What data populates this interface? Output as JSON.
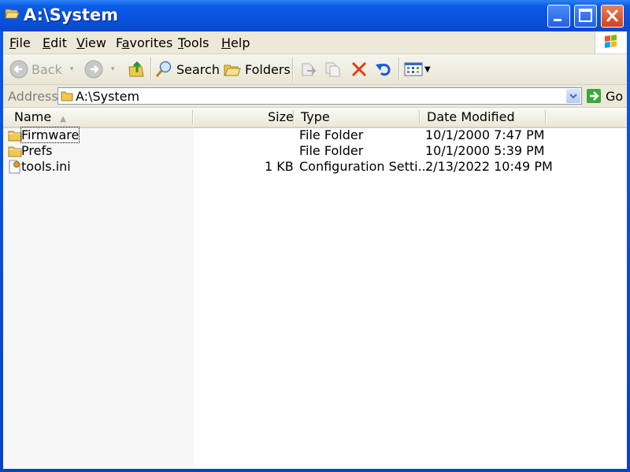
{
  "window": {
    "title": "A:\\System",
    "controls": {
      "minimize": "minimize",
      "maximize": "maximize",
      "close": "close"
    }
  },
  "menubar": {
    "items": [
      {
        "label": "File",
        "accel": "F"
      },
      {
        "label": "Edit",
        "accel": "E"
      },
      {
        "label": "View",
        "accel": "V"
      },
      {
        "label": "Favorites",
        "accel": "a"
      },
      {
        "label": "Tools",
        "accel": "T"
      },
      {
        "label": "Help",
        "accel": "H"
      }
    ]
  },
  "toolbar": {
    "back_label": "Back",
    "search_label": "Search",
    "folders_label": "Folders"
  },
  "address": {
    "label": "Address",
    "value": "A:\\System",
    "go_label": "Go"
  },
  "list": {
    "columns": [
      {
        "label": "Name",
        "sorted": "ascending"
      },
      {
        "label": "Size"
      },
      {
        "label": "Type"
      },
      {
        "label": "Date Modified"
      }
    ],
    "rows": [
      {
        "name": "Firmware",
        "size": "",
        "type": "File Folder",
        "modified": "10/1/2000 7:47 PM",
        "icon": "folder-icon",
        "focused": true
      },
      {
        "name": "Prefs",
        "size": "",
        "type": "File Folder",
        "modified": "10/1/2000 5:39 PM",
        "icon": "folder-icon"
      },
      {
        "name": "tools.ini",
        "size": "1 KB",
        "type": "Configuration Setti...",
        "modified": "2/13/2022 10:49 PM",
        "icon": "config-file-icon"
      }
    ]
  }
}
